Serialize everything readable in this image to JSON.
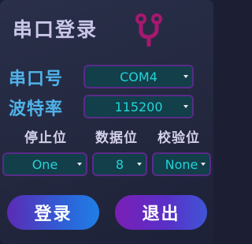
{
  "title": "串口登录",
  "logo_icon": "branch-icon",
  "colors": {
    "label_blue": "#4fb3ea",
    "select_bg": "#123f4a",
    "select_text": "#23d3d6",
    "select_border": "#5a2a8a",
    "logo": "#a7186f"
  },
  "port": {
    "label": "串口号",
    "value": "COM4"
  },
  "baud": {
    "label": "波特率",
    "value": "115200"
  },
  "stop_bits": {
    "label": "停止位",
    "value": "One"
  },
  "data_bits": {
    "label": "数据位",
    "value": "8"
  },
  "parity": {
    "label": "校验位",
    "value": "None"
  },
  "buttons": {
    "login": "登录",
    "exit": "退出"
  }
}
